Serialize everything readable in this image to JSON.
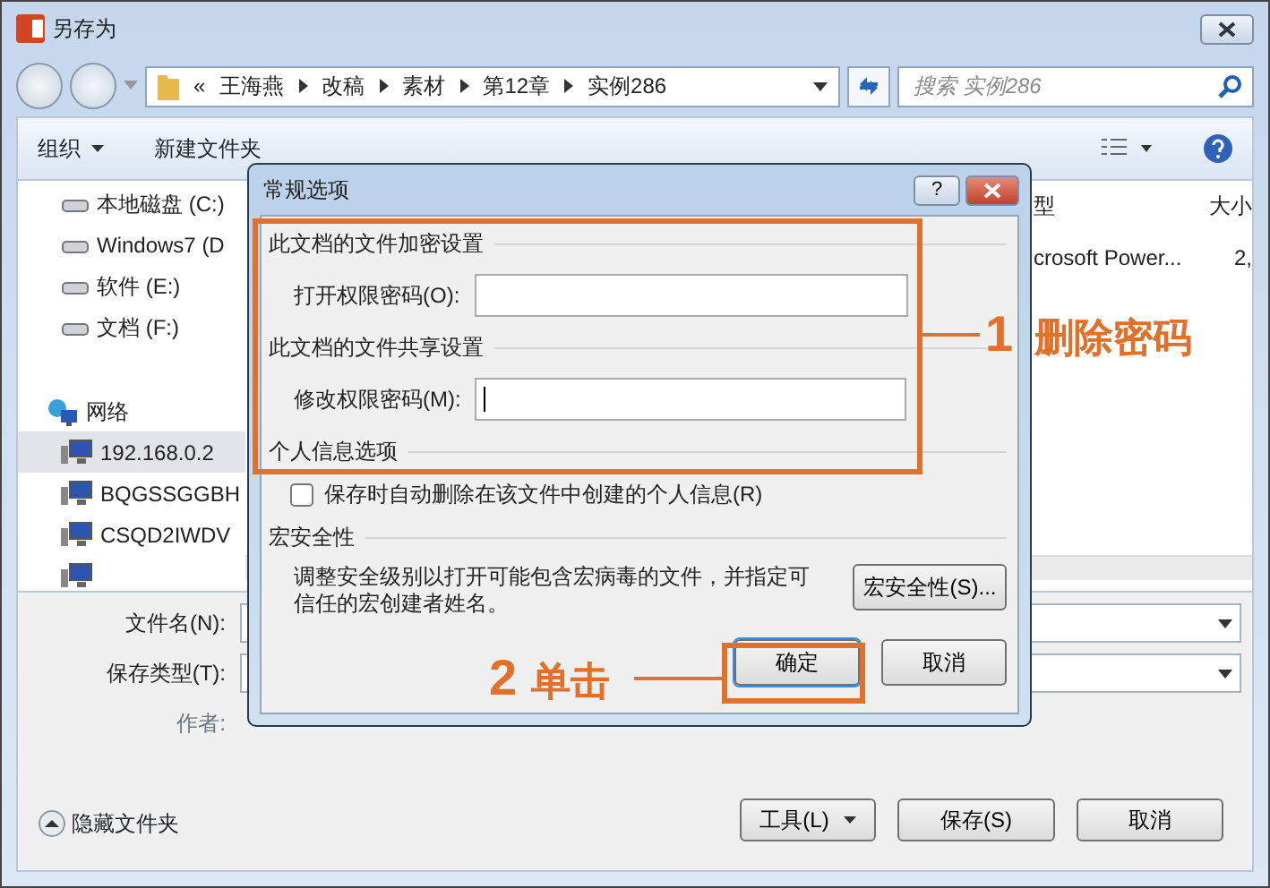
{
  "window": {
    "title": "另存为"
  },
  "address_bar": {
    "overflow": "«",
    "crumbs": [
      "王海燕",
      "改稿",
      "素材",
      "第12章",
      "实例286"
    ]
  },
  "search": {
    "placeholder": "搜索 实例286"
  },
  "toolbar": {
    "organize": "组织",
    "new_folder": "新建文件夹"
  },
  "sidebar": {
    "items": [
      {
        "label": "本地磁盘 (C:)",
        "kind": "drive",
        "selected": false
      },
      {
        "label": "Windows7 (D",
        "kind": "drive",
        "selected": false
      },
      {
        "label": "软件 (E:)",
        "kind": "drive",
        "selected": false
      },
      {
        "label": "文档 (F:)",
        "kind": "drive",
        "selected": false
      },
      {
        "label": "网络",
        "kind": "network",
        "selected": false
      },
      {
        "label": "192.168.0.2",
        "kind": "computer",
        "selected": true
      },
      {
        "label": "BQGSSGGBH",
        "kind": "computer",
        "selected": false
      },
      {
        "label": "CSQD2IWDV",
        "kind": "computer",
        "selected": false
      },
      {
        "kind": "computer",
        "selected": false
      }
    ]
  },
  "file_list": {
    "columns": [
      "型",
      "大小"
    ],
    "rows": [
      [
        "crosoft Power...",
        "2,"
      ]
    ]
  },
  "form": {
    "fields": [
      {
        "label": "文件名(N):"
      },
      {
        "label": "保存类型(T):"
      }
    ],
    "author_label": "作者:"
  },
  "hide_folders": "隐藏文件夹",
  "buttons": [
    {
      "label": "工具(L)",
      "kind": "menu"
    },
    {
      "label": "保存(S)",
      "kind": "plain"
    },
    {
      "label": "取消",
      "kind": "plain"
    }
  ],
  "dialog": {
    "title": "常规选项",
    "help": "?",
    "encrypt": {
      "heading": "此文档的文件加密设置",
      "label": "打开权限密码(O):"
    },
    "share": {
      "heading": "此文档的文件共享设置",
      "label": "修改权限密码(M):"
    },
    "privacy": {
      "heading": "个人信息选项",
      "checkbox": {
        "label": "保存时自动删除在该文件中创建的个人信息(R)",
        "checked": false
      }
    },
    "macro": {
      "heading": "宏安全性",
      "text": "调整安全级别以打开可能包含宏病毒的文件，并指定可信任的宏创建者姓名。",
      "button": "宏安全性(S)..."
    },
    "buttons": [
      {
        "label": "确定",
        "highlighted": true
      },
      {
        "label": "取消",
        "highlighted": false
      }
    ]
  },
  "annotations": [
    {
      "number": "1",
      "text": "删除密码"
    },
    {
      "number": "2",
      "text": "单击"
    }
  ]
}
